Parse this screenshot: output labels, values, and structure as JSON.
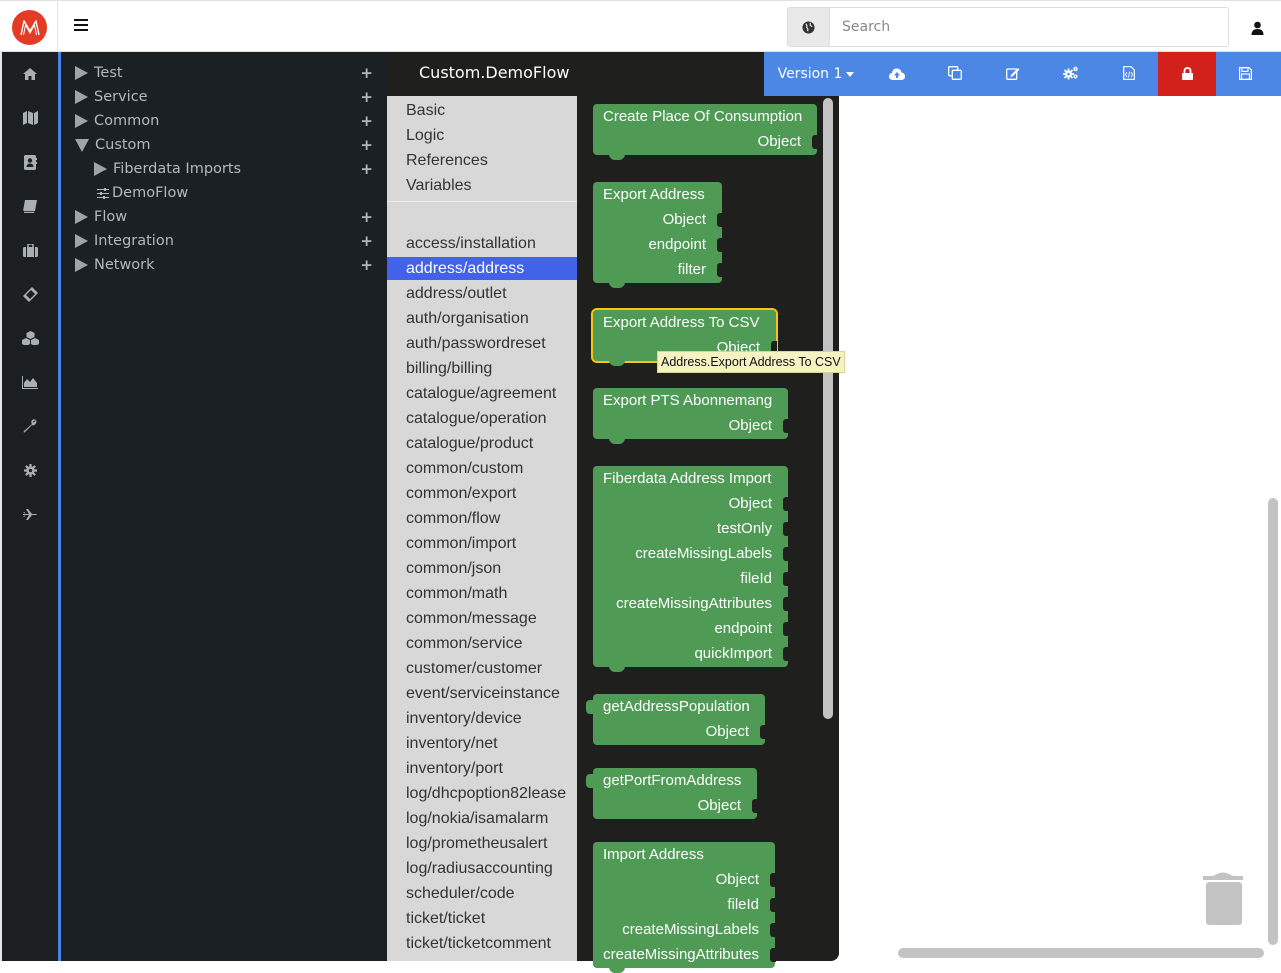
{
  "header": {
    "search_placeholder": "Search",
    "search_value": "",
    "icons": {
      "logo": "logo-m-icon",
      "menu": "hamburger-icon",
      "globe": "globe-icon",
      "user": "user-icon"
    }
  },
  "rail": {
    "items": [
      {
        "name": "home",
        "icon": "home-icon"
      },
      {
        "name": "map",
        "icon": "map-icon"
      },
      {
        "name": "contacts",
        "icon": "address-book-icon"
      },
      {
        "name": "book",
        "icon": "book-icon"
      },
      {
        "name": "briefcase",
        "icon": "briefcase-icon"
      },
      {
        "name": "ticket",
        "icon": "ticket-icon"
      },
      {
        "name": "cubes",
        "icon": "cubes-icon"
      },
      {
        "name": "chart",
        "icon": "area-chart-icon"
      },
      {
        "name": "tools",
        "icon": "wrench-icon"
      },
      {
        "name": "settings",
        "icon": "gear-icon"
      },
      {
        "name": "flight",
        "icon": "plane-icon"
      }
    ]
  },
  "tree": {
    "items": [
      {
        "label": "Test",
        "level": 0,
        "state": "collapsed",
        "has_add": true
      },
      {
        "label": "Service",
        "level": 0,
        "state": "collapsed",
        "has_add": true
      },
      {
        "label": "Common",
        "level": 0,
        "state": "collapsed",
        "has_add": true
      },
      {
        "label": "Custom",
        "level": 0,
        "state": "expanded",
        "has_add": true
      },
      {
        "label": "Fiberdata Imports",
        "level": 1,
        "state": "collapsed",
        "has_add": true
      },
      {
        "label": "DemoFlow",
        "level": 1,
        "state": "leaf",
        "has_add": false
      },
      {
        "label": "Flow",
        "level": 0,
        "state": "collapsed",
        "has_add": true
      },
      {
        "label": "Integration",
        "level": 0,
        "state": "collapsed",
        "has_add": true
      },
      {
        "label": "Network",
        "level": 0,
        "state": "collapsed",
        "has_add": true
      }
    ],
    "add_label": "+"
  },
  "editor": {
    "title": "Custom.DemoFlow",
    "toolbar": {
      "version_label": "Version 1",
      "buttons": [
        {
          "name": "upload",
          "icon": "cloud-upload-icon"
        },
        {
          "name": "copy",
          "icon": "copy-icon"
        },
        {
          "name": "edit",
          "icon": "edit-icon"
        },
        {
          "name": "settings",
          "icon": "gears-icon"
        },
        {
          "name": "code",
          "icon": "file-code-icon"
        },
        {
          "name": "lock",
          "icon": "lock-icon",
          "color": "#d2211b"
        },
        {
          "name": "save",
          "icon": "save-icon"
        }
      ]
    },
    "accent_color": "#4c87e5"
  },
  "categories": {
    "basic": [
      "Basic",
      "Logic",
      "References",
      "Variables"
    ],
    "modules": [
      "access/installation",
      "address/address",
      "address/outlet",
      "auth/organisation",
      "auth/passwordreset",
      "billing/billing",
      "catalogue/agreement",
      "catalogue/operation",
      "catalogue/product",
      "common/custom",
      "common/export",
      "common/flow",
      "common/import",
      "common/json",
      "common/math",
      "common/message",
      "common/service",
      "customer/customer",
      "event/serviceinstance",
      "inventory/device",
      "inventory/net",
      "inventory/port",
      "log/dhcpoption82lease",
      "log/nokia/isamalarm",
      "log/prometheusalert",
      "log/radiusaccounting",
      "scheduler/code",
      "ticket/ticket",
      "ticket/ticketcomment"
    ],
    "selected": "address/address"
  },
  "blocks": [
    {
      "title": "Create Place Of Consumption",
      "fields": [
        "Object"
      ]
    },
    {
      "title": "Export Address",
      "fields": [
        "Object",
        "endpoint",
        "filter"
      ]
    },
    {
      "title": "Export Address To CSV",
      "fields": [
        "Object"
      ],
      "selected": true
    },
    {
      "title": "Export PTS Abonnemang",
      "fields": [
        "Object"
      ]
    },
    {
      "title": "Fiberdata Address Import",
      "fields": [
        "Object",
        "testOnly",
        "createMissingLabels",
        "fileId",
        "createMissingAttributes",
        "endpoint",
        "quickImport"
      ]
    },
    {
      "title": "getAddressPopulation",
      "fields": [
        "Object"
      ]
    },
    {
      "title": "getPortFromAddress",
      "fields": [
        "Object"
      ]
    },
    {
      "title": "Import Address",
      "fields": [
        "Object",
        "fileId",
        "createMissingLabels",
        "createMissingAttributes"
      ]
    }
  ],
  "tooltip": "Address.Export Address To CSV",
  "workspace": {
    "trash_icon": "trash-icon"
  },
  "colors": {
    "block_green": "#4f9a55",
    "category_selected": "#4262ea",
    "lock_red": "#d2211b",
    "logo_red": "#e43b26"
  }
}
